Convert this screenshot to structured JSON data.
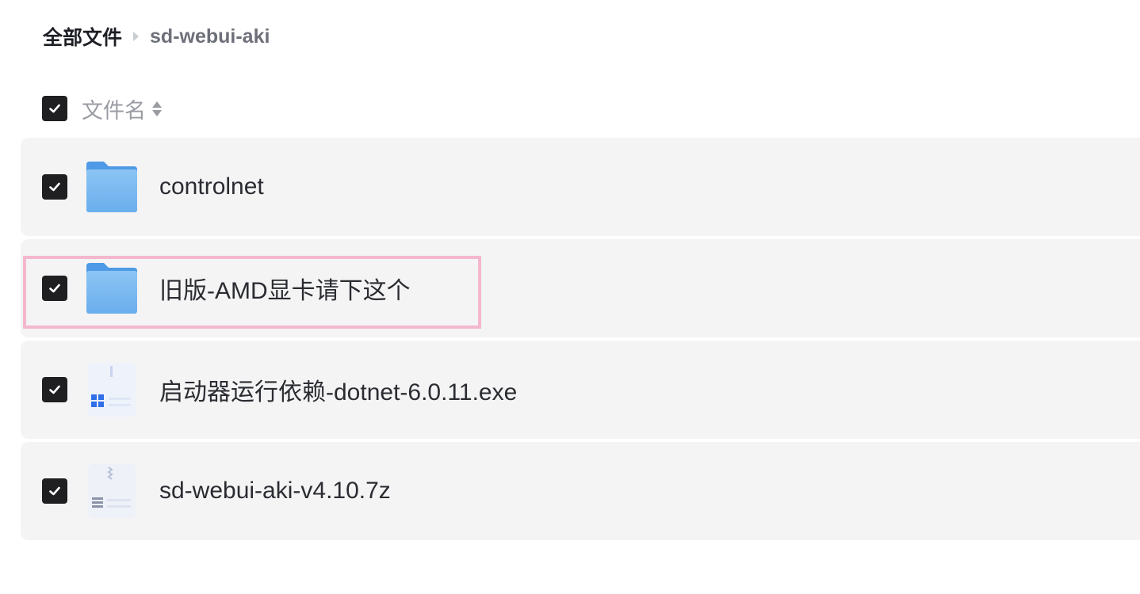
{
  "breadcrumb": {
    "root": "全部文件",
    "current": "sd-webui-aki"
  },
  "list_header": {
    "label": "文件名",
    "select_all_checked": true,
    "sort_icon": "sort-icon"
  },
  "files": [
    {
      "name": "controlnet",
      "type": "folder",
      "icon": "folder-icon",
      "checked": true
    },
    {
      "name": "旧版-AMD显卡请下这个",
      "type": "folder",
      "icon": "folder-icon",
      "checked": true,
      "highlighted": true
    },
    {
      "name": "启动器运行依赖-dotnet-6.0.11.exe",
      "type": "exe",
      "icon": "exe-file-icon",
      "checked": true
    },
    {
      "name": "sd-webui-aki-v4.10.7z",
      "type": "archive",
      "icon": "archive-file-icon",
      "checked": true
    }
  ],
  "colors": {
    "row_background": "#f4f4f5",
    "checkbox": "#1f1f22",
    "highlight_border": "#f4b7ce",
    "folder_blue": "#6fb2ef"
  }
}
